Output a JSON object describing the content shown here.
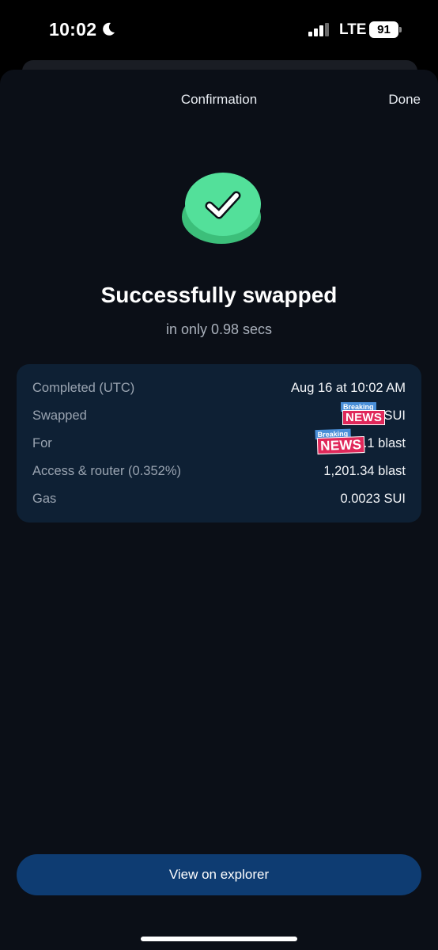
{
  "status_bar": {
    "time": "10:02",
    "network": "LTE",
    "battery": "91"
  },
  "nav": {
    "title": "Confirmation",
    "done_label": "Done"
  },
  "result": {
    "headline": "Successfully swapped",
    "subline": "in only 0.98 secs",
    "icon": "checkmark-icon",
    "accent_color": "#4fdc93"
  },
  "details": [
    {
      "label": "Completed (UTC)",
      "value": "Aug 16 at 10:02 AM"
    },
    {
      "label": "Swapped",
      "value": "SUI"
    },
    {
      "label": "For",
      "value": ".1 blast"
    },
    {
      "label": "Access & router (0.352%)",
      "value": "1,201.34 blast"
    },
    {
      "label": "Gas",
      "value": "0.0023 SUI"
    }
  ],
  "stickers": {
    "small": "Breaking",
    "large": "NEWS"
  },
  "footer": {
    "explorer_label": "View on explorer"
  }
}
